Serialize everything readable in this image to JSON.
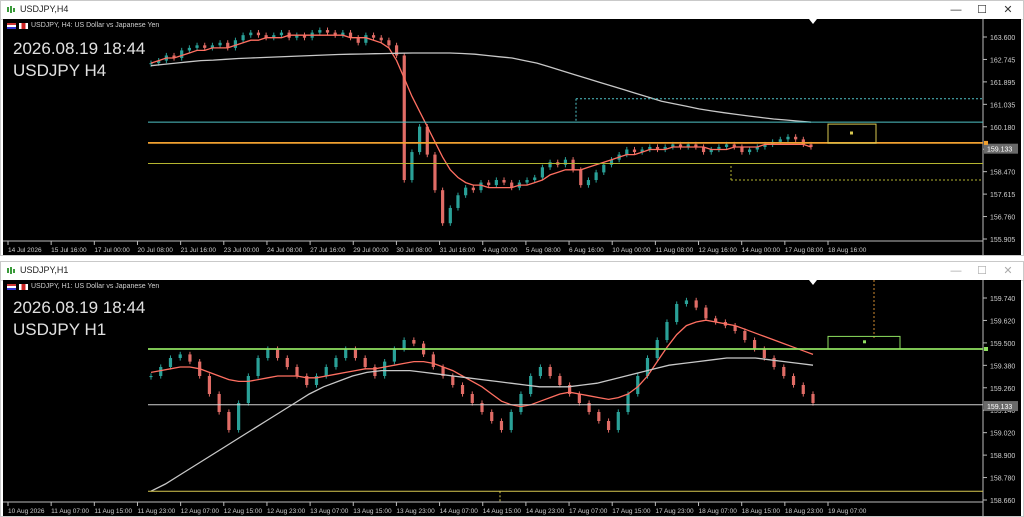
{
  "windows": [
    {
      "id": "h4",
      "title": "USDJPY,H4",
      "info": "USDJPY, H4:  US Dollar vs Japanese Yen",
      "overlay_time": "2026.08.19 18:44",
      "overlay_symbol": "USDJPY H4",
      "price_labels": [
        "163.600",
        "162.745",
        "161.895",
        "161.035",
        "160.180",
        "159.325",
        "158.470",
        "157.615",
        "156.760",
        "155.905"
      ],
      "current_price": "159.133",
      "time_labels": [
        "14 Jul 2026",
        "15 Jul 16:00",
        "17 Jul 00:00",
        "20 Jul 08:00",
        "21 Jul 16:00",
        "23 Jul 00:00",
        "24 Jul 08:00",
        "27 Jul 16:00",
        "29 Jul 00:00",
        "30 Jul 08:00",
        "31 Jul 16:00",
        "4 Aug 00:00",
        "5 Aug 08:00",
        "6 Aug 16:00",
        "10 Aug 00:00",
        "11 Aug 08:00",
        "12 Aug 16:00",
        "14 Aug 00:00",
        "17 Aug 08:00",
        "18 Aug 16:00"
      ],
      "ylim": [
        155.5,
        164.0
      ],
      "levels": {
        "orange": 159.36,
        "cyan": 160.18,
        "olive": 158.55
      },
      "candles": [
        162.5,
        162.6,
        162.8,
        162.7,
        163.0,
        163.1,
        163.2,
        163.1,
        163.2,
        163.3,
        163.1,
        163.4,
        163.6,
        163.7,
        163.6,
        163.5,
        163.6,
        163.7,
        163.5,
        163.6,
        163.5,
        163.7,
        163.8,
        163.7,
        163.6,
        163.7,
        163.5,
        163.3,
        163.6,
        163.5,
        163.4,
        163.2,
        162.8,
        157.9,
        159.0,
        160.0,
        158.9,
        157.5,
        156.2,
        156.8,
        157.3,
        157.6,
        157.5,
        157.8,
        157.7,
        157.9,
        157.8,
        157.6,
        157.8,
        157.9,
        158.0,
        158.4,
        158.6,
        158.5,
        158.7,
        158.3,
        157.7,
        157.9,
        158.2,
        158.5,
        158.7,
        158.9,
        159.1,
        159.0,
        159.1,
        159.2,
        159.1,
        159.2,
        159.3,
        159.2,
        159.3,
        159.2,
        159.0,
        159.1,
        159.2,
        159.3,
        159.2,
        159.0,
        159.1,
        159.2,
        159.3,
        159.4,
        159.5,
        159.6,
        159.5,
        159.3,
        159.2
      ],
      "ma_red": [
        162.5,
        162.6,
        162.7,
        162.7,
        162.8,
        162.9,
        163.0,
        163.0,
        163.1,
        163.1,
        163.1,
        163.2,
        163.3,
        163.4,
        163.4,
        163.5,
        163.5,
        163.5,
        163.6,
        163.6,
        163.6,
        163.6,
        163.6,
        163.6,
        163.6,
        163.6,
        163.5,
        163.5,
        163.5,
        163.4,
        163.3,
        163.1,
        162.6,
        161.9,
        161.2,
        160.6,
        160.0,
        159.4,
        158.8,
        158.3,
        158.0,
        157.8,
        157.7,
        157.7,
        157.6,
        157.6,
        157.6,
        157.6,
        157.7,
        157.7,
        157.8,
        157.9,
        158.1,
        158.2,
        158.3,
        158.3,
        158.3,
        158.4,
        158.5,
        158.6,
        158.7,
        158.8,
        158.9,
        158.9,
        159.0,
        159.1,
        159.1,
        159.1,
        159.2,
        159.2,
        159.2,
        159.2,
        159.2,
        159.1,
        159.1,
        159.1,
        159.2,
        159.2,
        159.2,
        159.2,
        159.3,
        159.3,
        159.3,
        159.3,
        159.3,
        159.3,
        159.2
      ],
      "ma_white": [
        162.4,
        162.45,
        162.5,
        162.55,
        162.6,
        162.62,
        162.65,
        162.68,
        162.7,
        162.72,
        162.74,
        162.76,
        162.78,
        162.8,
        162.82,
        162.84,
        162.85,
        162.86,
        162.87,
        162.88,
        162.89,
        162.9,
        162.9,
        162.9,
        162.9,
        162.88,
        162.85,
        162.8,
        162.75,
        162.7,
        162.6,
        162.5,
        162.35,
        162.2,
        162.05,
        161.9,
        161.75,
        161.6,
        161.45,
        161.3,
        161.15,
        161.0,
        160.9,
        160.8,
        160.7,
        160.62,
        160.55,
        160.48,
        160.42,
        160.36,
        160.3,
        160.26,
        160.22,
        160.18
      ]
    },
    {
      "id": "h1",
      "title": "USDJPY,H1",
      "info": "USDJPY, H1:  US Dollar vs Japanese Yen",
      "overlay_time": "2026.08.19 18:44",
      "overlay_symbol": "USDJPY H1",
      "price_labels": [
        "159.740",
        "159.620",
        "159.500",
        "159.380",
        "159.260",
        "159.140",
        "159.020",
        "158.900",
        "158.780",
        "158.660"
      ],
      "current_price": "159.133",
      "time_labels": [
        "10 Aug 2026",
        "11 Aug 07:00",
        "11 Aug 15:00",
        "11 Aug 23:00",
        "12 Aug 07:00",
        "12 Aug 15:00",
        "12 Aug 23:00",
        "13 Aug 07:00",
        "13 Aug 15:00",
        "13 Aug 23:00",
        "14 Aug 07:00",
        "14 Aug 15:00",
        "14 Aug 23:00",
        "17 Aug 07:00",
        "17 Aug 15:00",
        "17 Aug 23:00",
        "18 Aug 07:00",
        "18 Aug 15:00",
        "18 Aug 23:00",
        "19 Aug 07:00"
      ],
      "ylim": [
        158.6,
        159.8
      ],
      "levels": {
        "green": 159.45,
        "white": 159.14,
        "yellow": 158.66
      },
      "candles": [
        159.3,
        159.35,
        159.4,
        159.42,
        159.38,
        159.3,
        159.2,
        159.1,
        159.0,
        159.15,
        159.3,
        159.4,
        159.45,
        159.4,
        159.35,
        159.3,
        159.25,
        159.3,
        159.35,
        159.4,
        159.45,
        159.4,
        159.35,
        159.3,
        159.38,
        159.45,
        159.5,
        159.48,
        159.42,
        159.35,
        159.3,
        159.25,
        159.2,
        159.15,
        159.1,
        159.05,
        159.0,
        159.1,
        159.2,
        159.3,
        159.35,
        159.3,
        159.25,
        159.2,
        159.15,
        159.1,
        159.05,
        159.0,
        159.1,
        159.2,
        159.3,
        159.4,
        159.5,
        159.6,
        159.7,
        159.72,
        159.68,
        159.62,
        159.6,
        159.58,
        159.55,
        159.5,
        159.45,
        159.4,
        159.35,
        159.3,
        159.25,
        159.2,
        159.15
      ],
      "ma_red": [
        159.32,
        159.33,
        159.34,
        159.35,
        159.35,
        159.34,
        159.32,
        159.3,
        159.28,
        159.27,
        159.27,
        159.28,
        159.29,
        159.3,
        159.3,
        159.3,
        159.29,
        159.29,
        159.3,
        159.31,
        159.32,
        159.33,
        159.34,
        159.34,
        159.35,
        159.36,
        159.37,
        159.38,
        159.38,
        159.37,
        159.35,
        159.33,
        159.3,
        159.27,
        159.24,
        159.2,
        159.16,
        159.14,
        159.13,
        159.14,
        159.16,
        159.18,
        159.2,
        159.21,
        159.2,
        159.19,
        159.18,
        159.17,
        159.18,
        159.2,
        159.24,
        159.3,
        159.38,
        159.46,
        159.53,
        159.58,
        159.6,
        159.61,
        159.6,
        159.59,
        159.58,
        159.56,
        159.54,
        159.52,
        159.5,
        159.48,
        159.46,
        159.44,
        159.42
      ],
      "ma_white": [
        158.66,
        158.7,
        158.75,
        158.8,
        158.85,
        158.9,
        158.95,
        159.0,
        159.05,
        159.1,
        159.15,
        159.2,
        159.24,
        159.27,
        159.3,
        159.32,
        159.33,
        159.33,
        159.33,
        159.32,
        159.31,
        159.3,
        159.29,
        159.28,
        159.27,
        159.26,
        159.25,
        159.24,
        159.24,
        159.24,
        159.25,
        159.26,
        159.28,
        159.3,
        159.32,
        159.34,
        159.36,
        159.37,
        159.38,
        159.39,
        159.4,
        159.4,
        159.4,
        159.39,
        159.38,
        159.37,
        159.36
      ]
    }
  ],
  "colors": {
    "bull": "#2aa198",
    "bear": "#e06c66",
    "ma_red": "#ff6f61",
    "ma_white": "#c8c8c8",
    "orange_level": "#f0a030",
    "cyan_level": "#4fc3c7",
    "olive_level": "#b5b530",
    "green_level": "#8fe060",
    "yellow_level": "#d8c850",
    "white_level": "#d0d0d0"
  },
  "window_buttons": {
    "minimize": "—",
    "maximize": "☐",
    "close": "✕"
  }
}
